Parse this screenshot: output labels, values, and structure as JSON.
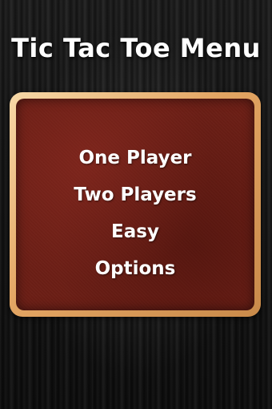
{
  "title": "Tic Tac Toe Menu",
  "menu": {
    "items": [
      {
        "label": "One Player"
      },
      {
        "label": "Two Players"
      },
      {
        "label": "Easy"
      },
      {
        "label": "Options"
      }
    ]
  },
  "colors": {
    "background": "#161616",
    "board": "#6b1e15",
    "frame": "#e3a563",
    "text": "#ffffff"
  }
}
